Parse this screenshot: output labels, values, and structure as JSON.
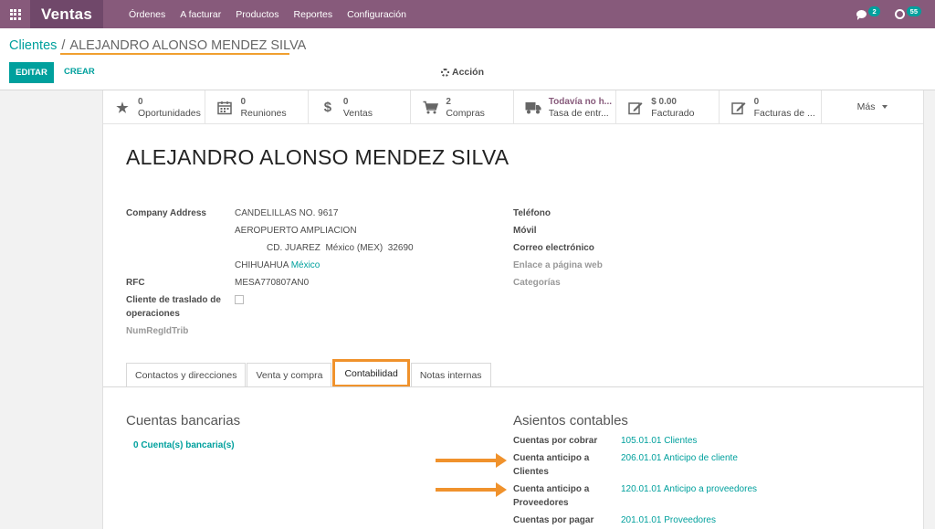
{
  "app": {
    "name": "Ventas"
  },
  "menu": [
    "Órdenes",
    "A facturar",
    "Productos",
    "Reportes",
    "Configuración"
  ],
  "systray": {
    "messages_count": "2",
    "activities_count": "55"
  },
  "breadcrumb": {
    "parent": "Clientes",
    "separator": "/",
    "current": "ALEJANDRO ALONSO MENDEZ SILVA"
  },
  "toolbar": {
    "edit_label": "EDITAR",
    "create_label": "CREAR",
    "action_label": "Acción"
  },
  "smart_buttons": [
    {
      "icon": "star-icon",
      "value": "0",
      "label": "Oportunidades"
    },
    {
      "icon": "calendar-icon",
      "value": "0",
      "label": "Reuniones"
    },
    {
      "icon": "dollar-icon",
      "value": "0",
      "label": "Ventas"
    },
    {
      "icon": "cart-icon",
      "value": "2",
      "label": "Compras"
    },
    {
      "icon": "truck-icon",
      "value": "Todavía no h...",
      "label": "Tasa de entr..."
    },
    {
      "icon": "edit-icon",
      "value": "$ 0.00",
      "label": "Facturado"
    },
    {
      "icon": "edit-icon",
      "value": "0",
      "label": "Facturas de ..."
    }
  ],
  "more_label": "Más",
  "partner": {
    "name": "ALEJANDRO ALONSO MENDEZ SILVA",
    "address_label": "Company Address",
    "street": "CANDELILLAS NO. 9617",
    "street2": "AEROPUERTO AMPLIACION",
    "city_line": "CD. JUAREZ  México (MEX)  32690",
    "state": "CHIHUAHUA",
    "country": "México",
    "rfc_label": "RFC",
    "rfc": "MESA770807AN0",
    "traslado_label_1": "Cliente de traslado de",
    "traslado_label_2": "operaciones",
    "numreg_label": "NumRegIdTrib",
    "phone_label": "Teléfono",
    "mobile_label": "Móvil",
    "email_label": "Correo electrónico",
    "website_label": "Enlace a página web",
    "categories_label": "Categorías"
  },
  "tabs": [
    {
      "label": "Contactos y direcciones",
      "active": false
    },
    {
      "label": "Venta y compra",
      "active": false
    },
    {
      "label": "Contabilidad",
      "active": true
    },
    {
      "label": "Notas internas",
      "active": false
    }
  ],
  "accounting": {
    "bank_title": "Cuentas bancarias",
    "bank_link": "0 Cuenta(s) bancaria(s)",
    "entries_title": "Asientos contables",
    "rows": [
      {
        "label_1": "Cuentas por cobrar",
        "label_2": "",
        "value": "105.01.01 Clientes"
      },
      {
        "label_1": "Cuenta anticipo a",
        "label_2": "Clientes",
        "value": "206.01.01 Anticipo de cliente"
      },
      {
        "label_1": "Cuenta anticipo a",
        "label_2": "Proveedores",
        "value": "120.01.01 Anticipo a proveedores"
      },
      {
        "label_1": "Cuentas por pagar",
        "label_2": "",
        "value": "201.01.01 Proveedores"
      }
    ]
  },
  "colors": {
    "brand": "#875a7b",
    "accent": "#00a09d",
    "highlight": "#f0922c"
  }
}
